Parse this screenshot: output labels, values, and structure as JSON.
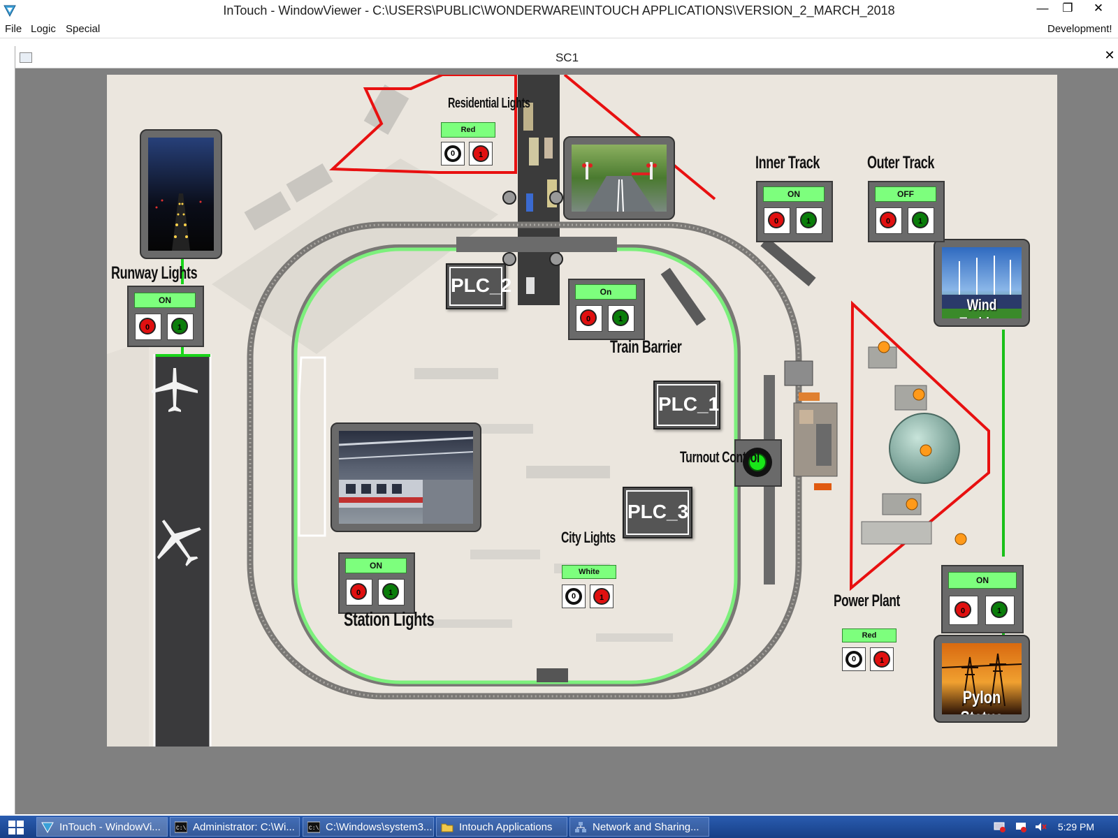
{
  "window": {
    "title": "InTouch - WindowViewer - C:\\USERS\\PUBLIC\\WONDERWARE\\INTOUCH APPLICATIONS\\VERSION_2_MARCH_2018",
    "minimize": "—",
    "restore": "❐",
    "close": "✕"
  },
  "menu": {
    "items": [
      "File",
      "Logic",
      "Special"
    ],
    "right_label": "Development!"
  },
  "child_window": {
    "title": "SC1",
    "close": "✕"
  },
  "controls": {
    "residential_lights": {
      "label": "Residential Lights",
      "status": "Red",
      "off": "0",
      "on": "1"
    },
    "inner_track": {
      "label": "Inner Track",
      "status": "ON",
      "off": "0",
      "on": "1"
    },
    "outer_track": {
      "label": "Outer Track",
      "status": "OFF",
      "off": "0",
      "on": "1"
    },
    "runway_lights": {
      "label": "Runway Lights",
      "status": "ON",
      "off": "0",
      "on": "1"
    },
    "train_barrier": {
      "label": "Train Barrier",
      "status": "On",
      "off": "0",
      "on": "1"
    },
    "station_lights": {
      "label": "Station Lights",
      "status": "ON",
      "off": "0",
      "on": "1"
    },
    "city_lights": {
      "label": "City Lights",
      "status": "White",
      "off": "0",
      "on": "1"
    },
    "power_plant": {
      "label": "Power Plant",
      "status": "Red",
      "off": "0",
      "on": "1"
    },
    "pylon_control": {
      "status": "ON",
      "off": "0",
      "on": "1"
    },
    "turnout_control": {
      "label": "Turnout Control",
      "indicator": "#19e619"
    }
  },
  "plcs": [
    "PLC_2",
    "PLC_1",
    "PLC_3"
  ],
  "image_labels": {
    "wind_turbine": "Wind Turbine",
    "pylon_status": "Pylon Status"
  },
  "colors": {
    "status_green": "#7dff7d",
    "button_red": "#e01010",
    "button_green": "#0a7d0a",
    "zone_red": "#e81010",
    "track_green": "#7cf07c"
  },
  "taskbar": {
    "items": [
      {
        "label": "InTouch - WindowVi...",
        "icon": "intouch-icon"
      },
      {
        "label": "Administrator: C:\\Wi...",
        "icon": "cmd-icon"
      },
      {
        "label": "C:\\Windows\\system3...",
        "icon": "cmd-icon"
      },
      {
        "label": "Intouch Applications",
        "icon": "folder-icon"
      },
      {
        "label": "Network and Sharing...",
        "icon": "network-icon"
      }
    ],
    "clock": "5:29 PM"
  }
}
